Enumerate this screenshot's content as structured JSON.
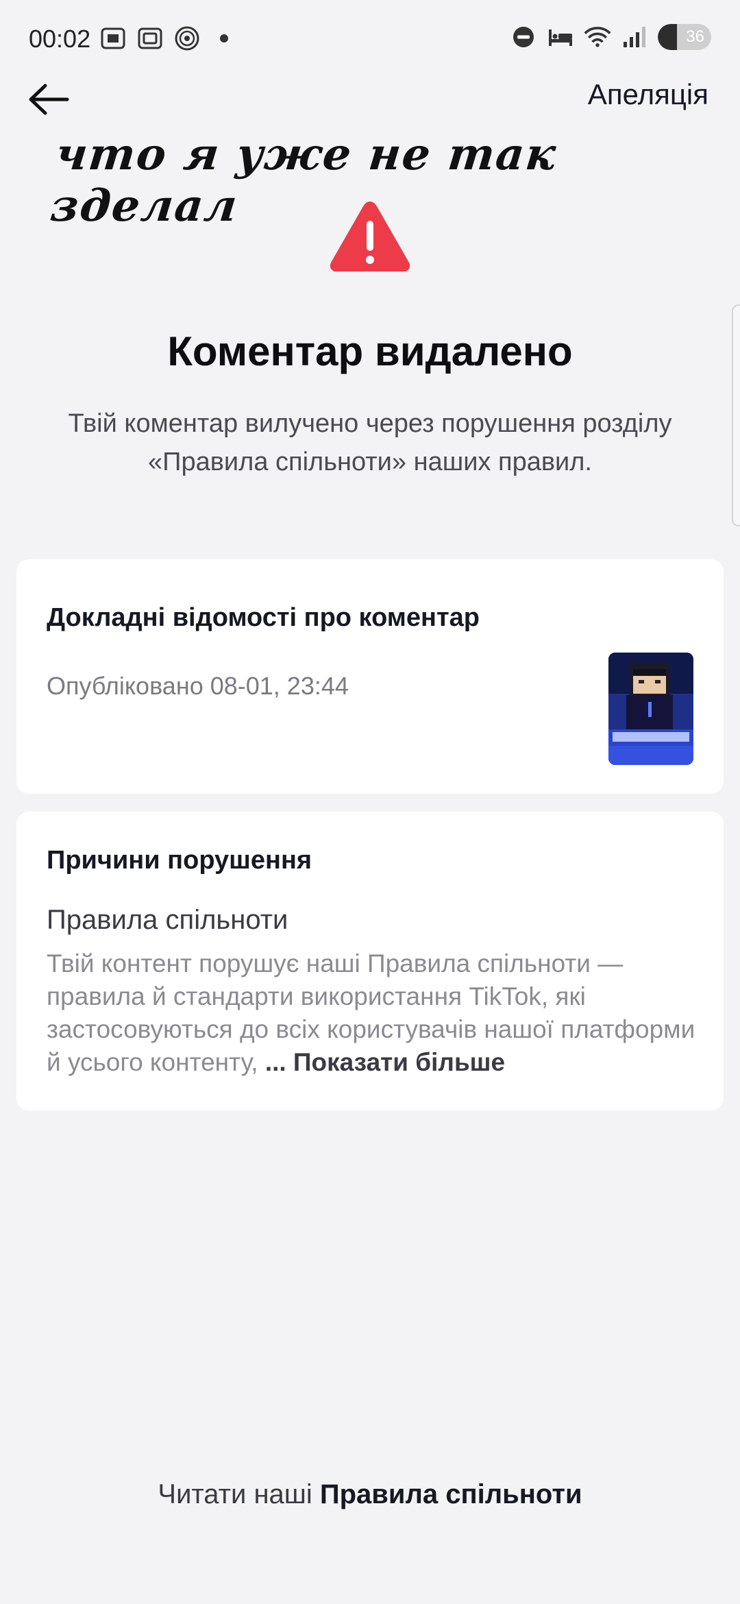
{
  "status_bar": {
    "time": "00:02",
    "battery_level": "36",
    "icons": [
      "screen-record-icon",
      "screenshot-icon",
      "cast-icon",
      "dot-icon",
      "dnd-icon",
      "bed-icon",
      "wifi-icon",
      "signal-icon",
      "battery-icon"
    ]
  },
  "nav": {
    "back_icon": "arrow-left-icon",
    "appeal_label": "Апеляція"
  },
  "handwritten_caption": "что я уже не так зделал",
  "main": {
    "warning_icon": "warning-triangle-icon",
    "warning_color": "#ee3b4a",
    "title": "Коментар видалено",
    "subtitle": "Твій коментар вилучено через порушення розділу «Правила спільноти» наших правил."
  },
  "details_card": {
    "heading": "Докладні відомості про коментар",
    "published": "Опубліковано 08-01, 23:44"
  },
  "reasons_card": {
    "heading": "Причини порушення",
    "rule_name": "Правила спільноти",
    "rule_description": "Твій контент порушує наші Правила спільноти — правила й стандарти використання TikTok, які застосовуються до всіх користувачів нашої платформи й усього контенту, ",
    "show_more_label": "... Показати більше"
  },
  "footer": {
    "prefix": "Читати наші ",
    "link_label": "Правила спільноти"
  }
}
